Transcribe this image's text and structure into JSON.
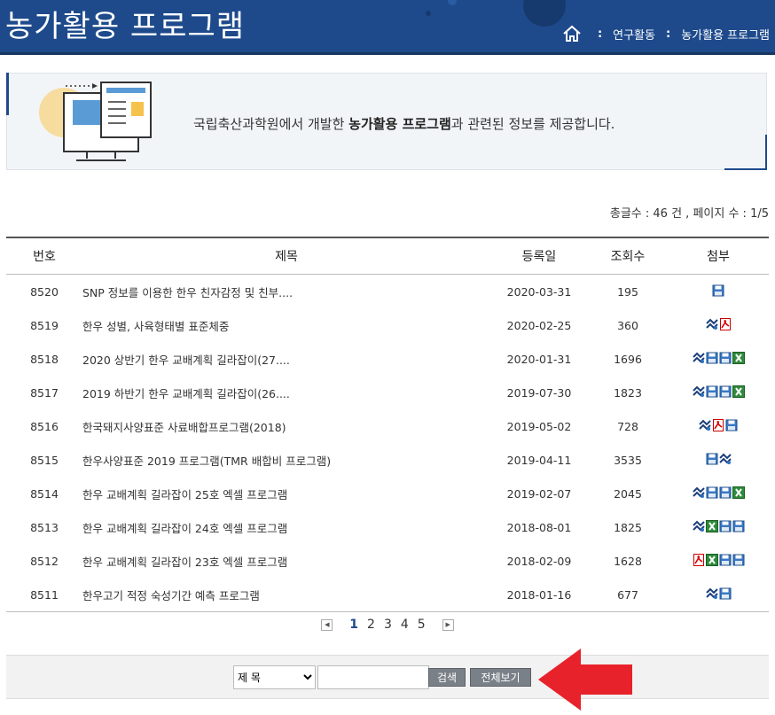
{
  "header": {
    "title": "농가활용 프로그램",
    "breadcrumb": [
      "연구활동",
      "농가활용 프로그램"
    ]
  },
  "intro": {
    "text_before": "국립축산과학원에서 개발한 ",
    "text_bold": "농가활용 프로그램",
    "text_after": "과 관련된 정보를 제공합니다."
  },
  "summary": "총글수 : 46 건 , 페이지 수 : 1/5",
  "table": {
    "headers": [
      "번호",
      "제목",
      "등록일",
      "조회수",
      "첨부"
    ],
    "rows": [
      {
        "no": "8520",
        "title": "SNP 정보를 이용한 한우 친자감정 및 친부....",
        "date": "2020-03-31",
        "views": "195",
        "atts": [
          "disk"
        ]
      },
      {
        "no": "8519",
        "title": "한우 성별, 사육형태별 표준체중",
        "date": "2020-02-25",
        "views": "360",
        "atts": [
          "hwp",
          "pdf"
        ]
      },
      {
        "no": "8518",
        "title": "2020 상반기 한우 교배계획 길라잡이(27....",
        "date": "2020-01-31",
        "views": "1696",
        "atts": [
          "hwp",
          "disk",
          "disk",
          "excel"
        ]
      },
      {
        "no": "8517",
        "title": "2019 하반기 한우 교배계획 길라잡이(26....",
        "date": "2019-07-30",
        "views": "1823",
        "atts": [
          "hwp",
          "disk",
          "disk",
          "excel"
        ]
      },
      {
        "no": "8516",
        "title": "한국돼지사양표준 사료배합프로그램(2018)",
        "date": "2019-05-02",
        "views": "728",
        "atts": [
          "hwp",
          "pdf",
          "disk"
        ]
      },
      {
        "no": "8515",
        "title": "한우사양표준 2019 프로그램(TMR 배합비 프로그램)",
        "date": "2019-04-11",
        "views": "3535",
        "atts": [
          "disk",
          "hwp"
        ]
      },
      {
        "no": "8514",
        "title": "한우 교배계획 길라잡이 25호 엑셀 프로그램",
        "date": "2019-02-07",
        "views": "2045",
        "atts": [
          "hwp",
          "disk",
          "disk",
          "excel"
        ]
      },
      {
        "no": "8513",
        "title": "한우 교배계획 길라잡이 24호 엑셀 프로그램",
        "date": "2018-08-01",
        "views": "1825",
        "atts": [
          "hwp",
          "excel",
          "disk",
          "disk"
        ]
      },
      {
        "no": "8512",
        "title": "한우 교배계획 길라잡이 23호 엑셀 프로그램",
        "date": "2018-02-09",
        "views": "1628",
        "atts": [
          "pdf",
          "excel",
          "disk",
          "disk"
        ]
      },
      {
        "no": "8511",
        "title": "한우고기 적정 숙성기간 예측 프로그램",
        "date": "2018-01-16",
        "views": "677",
        "atts": [
          "hwp",
          "disk"
        ]
      }
    ]
  },
  "pager": {
    "prev": "◀",
    "next": "▶",
    "pages": [
      "1",
      "2",
      "3",
      "4",
      "5"
    ],
    "current": "1"
  },
  "search": {
    "select_value": "제 목",
    "input_value": "",
    "search_label": "검색",
    "viewall_label": "전체보기"
  },
  "colors": {
    "header_bg": "#1e4a8c",
    "annotation_arrow": "#e8222a"
  }
}
